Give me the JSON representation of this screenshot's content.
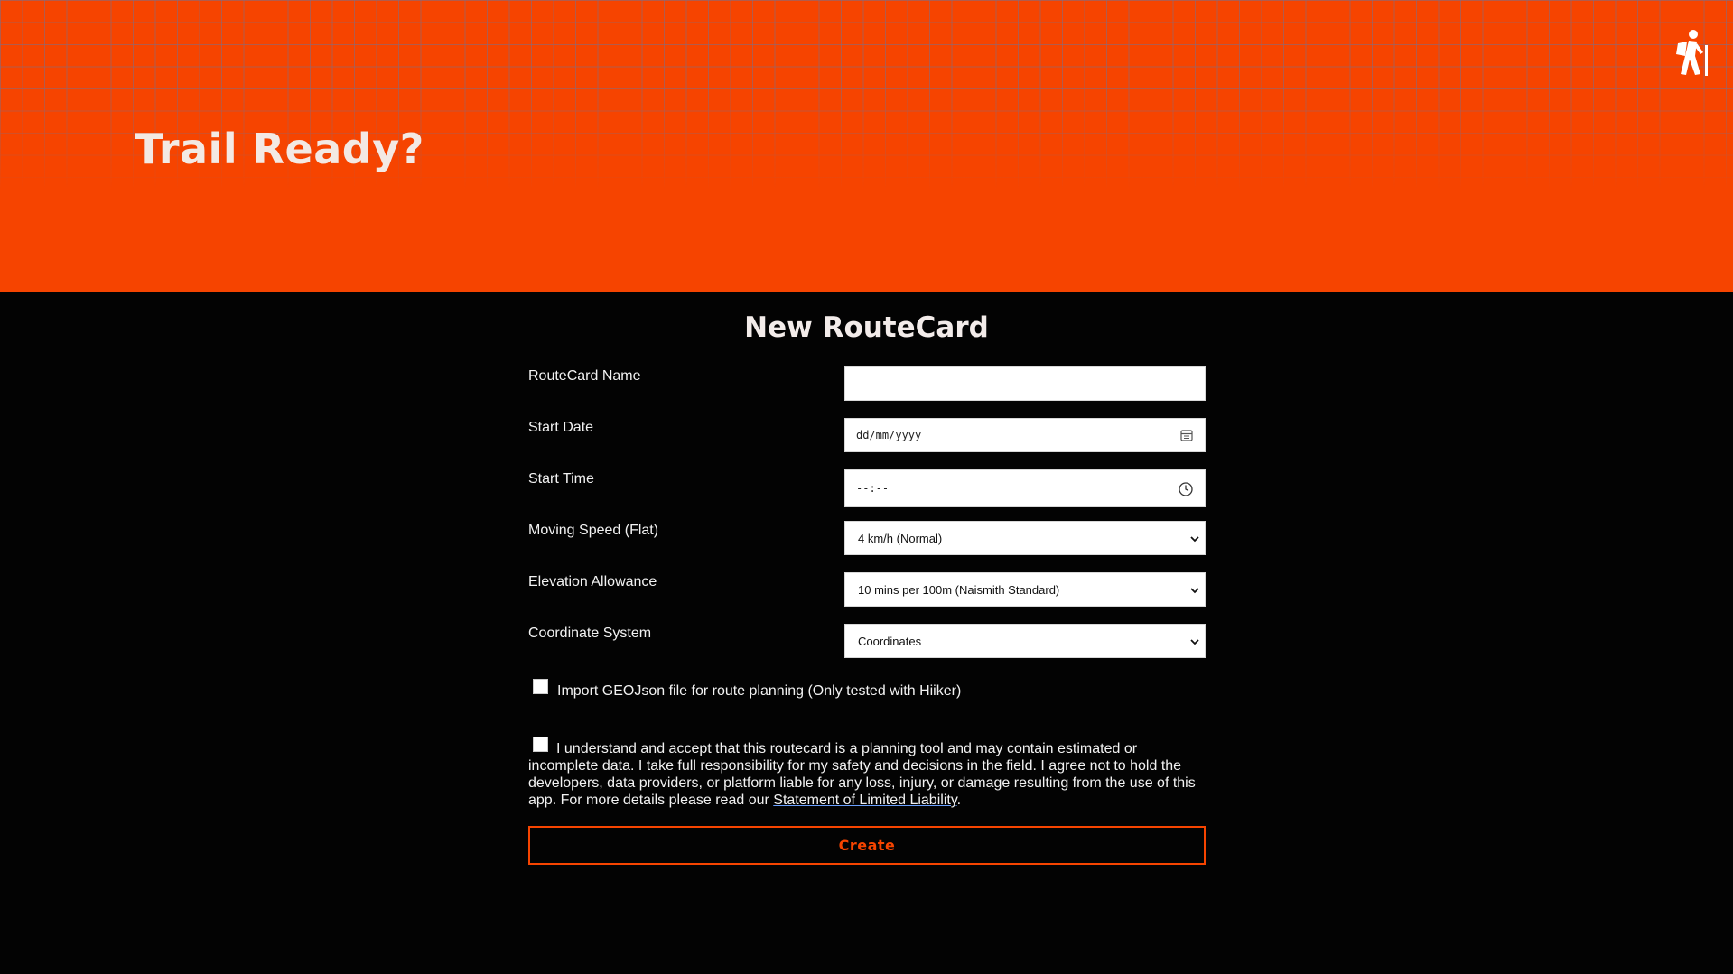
{
  "header": {
    "title": "Trail Ready?",
    "icon": "hiker-icon",
    "background_color": "#f64400"
  },
  "form": {
    "title": "New RouteCard",
    "fields": [
      {
        "label": "RouteCard Name",
        "value": "",
        "placeholder": ""
      },
      {
        "label": "Start Date",
        "placeholder": "dd/mm/yyyy",
        "icon": "calendar-icon"
      },
      {
        "label": "Start Time",
        "placeholder": "--:--",
        "icon": "clock-icon"
      },
      {
        "label": "Moving Speed (Flat)",
        "selected": "4 km/h (Normal)"
      },
      {
        "label": "Elevation Allowance",
        "selected": "10 mins per 100m (Naismith Standard)"
      },
      {
        "label": "Coordinate System",
        "selected": "Coordinates"
      }
    ],
    "import_checkbox": {
      "label": "Import GEOJson file for route planning (Only tested with Hiiker)",
      "checked": false
    },
    "terms_checkbox": {
      "text": "I understand and accept that this routecard is a planning tool and may contain estimated or incomplete data. I take full responsibility for my safety and decisions in the field. I agree not to hold the developers, data providers, or platform liable for any loss, injury, or damage resulting from the use of this app. For more details please read our ",
      "link": "Statement of Limited Liability",
      "suffix": ".",
      "checked": false
    },
    "submit_label": "Create",
    "accent_color": "#f64400"
  }
}
